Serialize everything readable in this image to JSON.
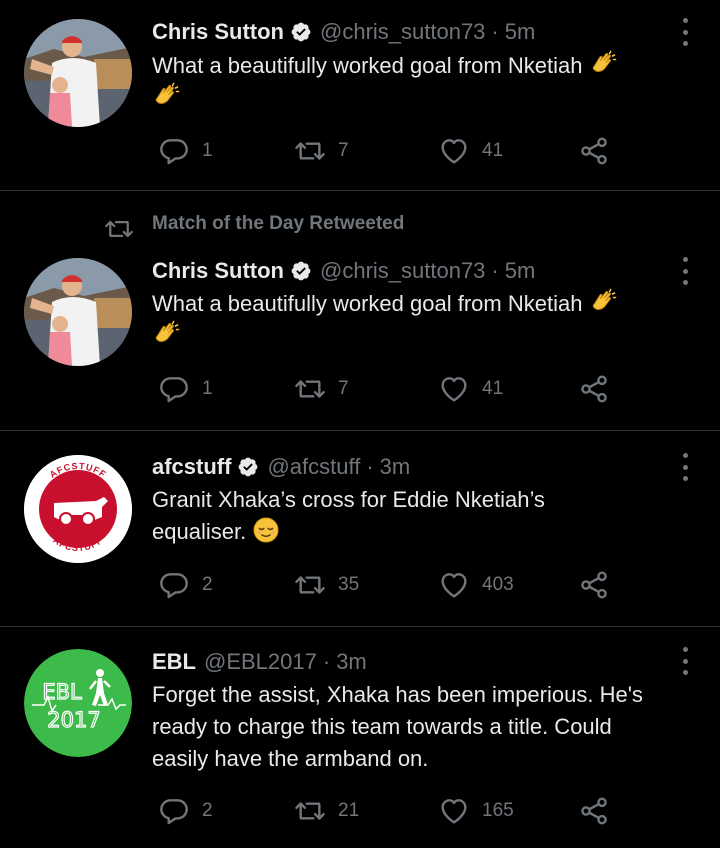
{
  "tweets": [
    {
      "name": "Chris Sutton",
      "verified": true,
      "handle": "@chris_sutton73",
      "sep": "·",
      "time": "5m",
      "text": "What a beautifully worked goal from Nketiah",
      "emoji": "clapping-hands",
      "replies": "1",
      "retweets": "7",
      "likes": "41"
    },
    {
      "retweeted_by": "Match of the Day Retweeted",
      "name": "Chris Sutton",
      "verified": true,
      "handle": "@chris_sutton73",
      "sep": "·",
      "time": "5m",
      "text": "What a beautifully worked goal from Nketiah",
      "emoji": "clapping-hands",
      "replies": "1",
      "retweets": "7",
      "likes": "41"
    },
    {
      "name": "afcstuff",
      "verified": true,
      "handle": "@afcstuff",
      "sep": "·",
      "time": "3m",
      "text_line1": "Granit Xhaka’s cross for Eddie Nketiah’s",
      "text_line2": "equaliser.",
      "emoji": "relieved-face",
      "avatar_text_top": "AFCSTUFF",
      "avatar_text_bottom": "AFCSTUFF",
      "replies": "2",
      "retweets": "35",
      "likes": "403"
    },
    {
      "name": "EBL",
      "verified": false,
      "handle": "@EBL2017",
      "sep": "·",
      "time": "3m",
      "text_line1": "Forget the assist, Xhaka has been imperious. He's",
      "text_line2": "ready to charge this team towards a title. Could",
      "text_line3": "easily have the armband on.",
      "avatar_text_top": "EBL",
      "avatar_text_bottom": "2017",
      "replies": "2",
      "retweets": "21",
      "likes": "165"
    }
  ],
  "colors": {
    "background": "#000000",
    "text": "#e7e9ea",
    "secondary": "#71767b",
    "divider": "#2f3336",
    "verified_badge": "#e7e9ea",
    "afcstuff_red": "#c8102e",
    "ebl_green": "#3dbb4a"
  }
}
